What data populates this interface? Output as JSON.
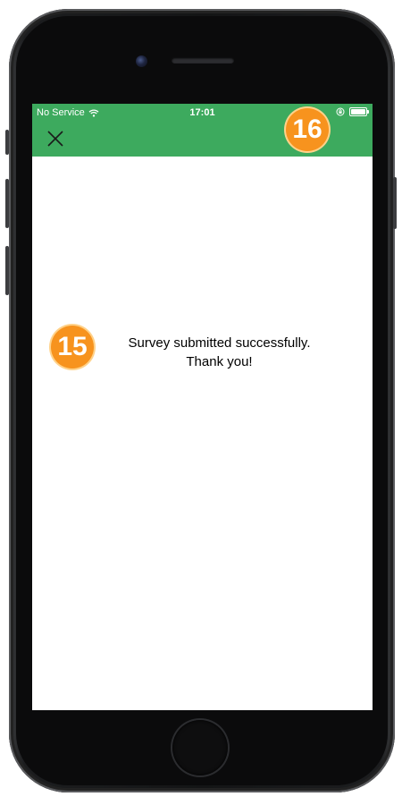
{
  "status_bar": {
    "carrier": "No Service",
    "time": "17:01",
    "wifi_icon": "wifi-icon",
    "lock_icon": "orientation-lock-icon",
    "battery_icon": "battery-icon"
  },
  "header": {
    "close_icon": "close-icon",
    "accent_color": "#3daa5e"
  },
  "annotations": {
    "badge_header": "16",
    "badge_message": "15",
    "badge_color": "#f7931e"
  },
  "message": {
    "line1": "Survey submitted successfully.",
    "line2": "Thank you!"
  }
}
